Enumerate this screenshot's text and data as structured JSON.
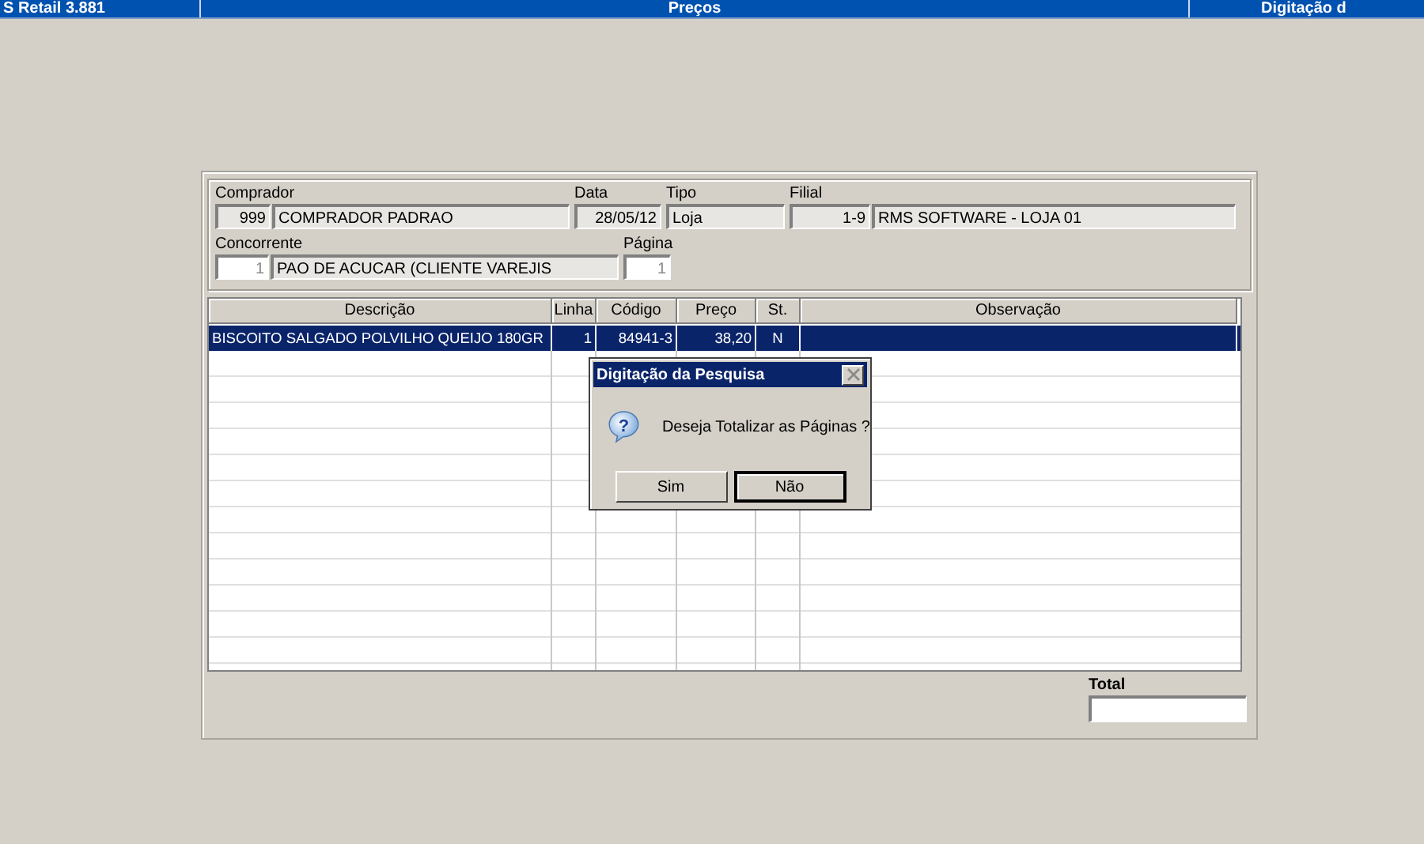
{
  "title_bar": {
    "left": "S Retail 3.881",
    "center": "Preços",
    "right": "Digitação d"
  },
  "header": {
    "rows": [
      [
        {
          "label": "Comprador",
          "fields": [
            {
              "value": "999",
              "disabled": false
            },
            {
              "value": "COMPRADOR PADRAO",
              "disabled": false
            }
          ]
        },
        {
          "label": "Data",
          "fields": [
            {
              "value": "28/05/12",
              "disabled": false
            }
          ]
        },
        {
          "label": "Tipo",
          "fields": [
            {
              "value": "Loja",
              "disabled": false
            }
          ]
        },
        {
          "label": "Filial",
          "fields": [
            {
              "value": "1-9",
              "disabled": false
            },
            {
              "value": "RMS SOFTWARE - LOJA 01",
              "disabled": false
            }
          ]
        }
      ],
      [
        {
          "label": "Concorrente",
          "fields": [
            {
              "value": "1",
              "disabled": true
            },
            {
              "value": "PAO DE ACUCAR (CLIENTE VAREJIS",
              "disabled": false
            }
          ]
        },
        {
          "label": "Página",
          "fields": [
            {
              "value": "1",
              "disabled": true
            }
          ]
        }
      ]
    ]
  },
  "table": {
    "columns": [
      "Descrição",
      "Linha",
      "Código",
      "Preço",
      "St.",
      "Observação"
    ],
    "rows": [
      {
        "cells": [
          "BISCOITO SALGADO POLVILHO QUEIJO 180GR",
          "1",
          "84941-3",
          "38,20",
          "N"
        ],
        "selected": true
      }
    ]
  },
  "total": {
    "label": "Total"
  },
  "dialog": {
    "title": "Digitação da Pesquisa",
    "icon": "?",
    "message": "Deseja Totalizar as Páginas ?",
    "buttons": [
      {
        "label": "Sim",
        "selected": false
      },
      {
        "label": "Não",
        "selected": true
      }
    ]
  }
}
